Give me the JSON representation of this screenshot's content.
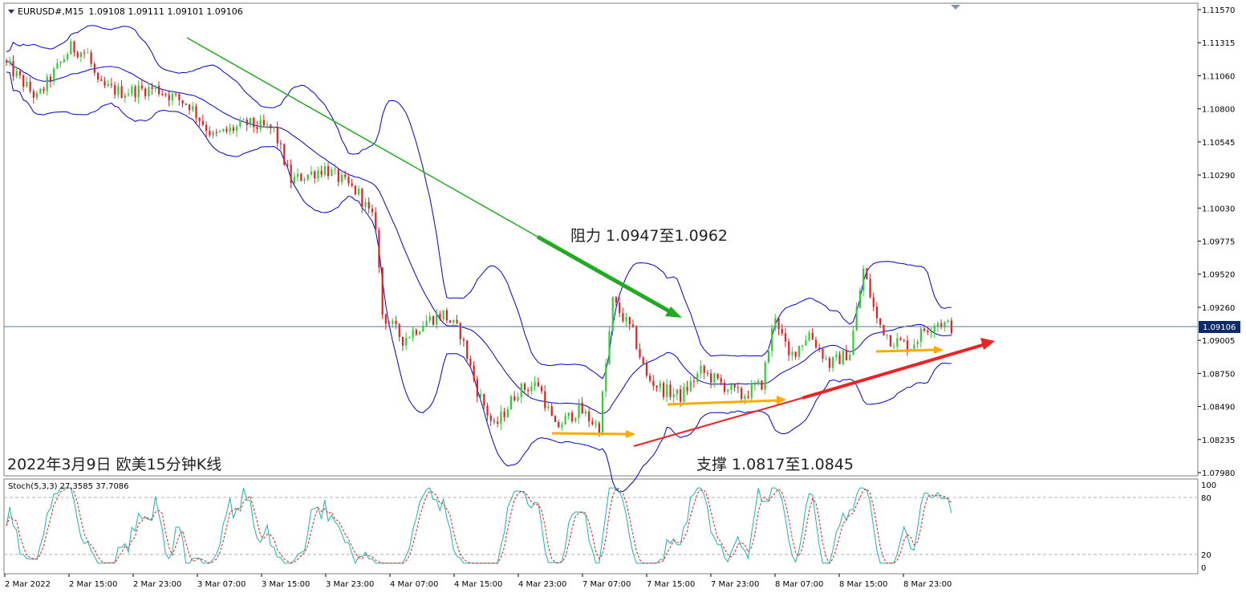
{
  "header": {
    "symbol": "EURUSD#,M15",
    "ohlc": "1.09108 1.09111 1.09101 1.09106"
  },
  "annotations": {
    "resistance": "阻力 1.0947至1.0962",
    "support": "支撑 1.0817至1.0845",
    "caption": "2022年3月9日 欧美15分钟K线"
  },
  "indicator": {
    "label": "Stoch(5,3,3) 27.3585 37.7086",
    "levels": [
      "100",
      "80",
      "20",
      "0"
    ]
  },
  "colors": {
    "up": "#33cc33",
    "down": "#dd2222",
    "band": "#0000cc",
    "resistance_arrow": "#22aa22",
    "support_arrow": "#ee2222",
    "horizontal_arrow": "#ffaa00",
    "stoch_main": "#20b2aa",
    "stoch_signal": "#dd2222"
  },
  "chart_data": {
    "type": "candlestick",
    "title": "EURUSD#,M15",
    "current_price": "1.09106",
    "y_ticks": [
      "1.11570",
      "1.11315",
      "1.11060",
      "1.10800",
      "1.10545",
      "1.10290",
      "1.10030",
      "1.09775",
      "1.09520",
      "1.09260",
      "1.09005",
      "1.08750",
      "1.08490",
      "1.08235",
      "1.07980"
    ],
    "ylim": [
      1.0795,
      1.116
    ],
    "x_ticks": [
      "2 Mar 2022",
      "2 Mar 15:00",
      "2 Mar 23:00",
      "3 Mar 07:00",
      "3 Mar 15:00",
      "3 Mar 23:00",
      "4 Mar 07:00",
      "4 Mar 15:00",
      "4 Mar 23:00",
      "7 Mar 07:00",
      "7 Mar 15:00",
      "7 Mar 23:00",
      "8 Mar 07:00",
      "8 Mar 15:00",
      "8 Mar 23:00"
    ],
    "price_path": [
      [
        0,
        1.112
      ],
      [
        5,
        1.1105
      ],
      [
        10,
        1.109
      ],
      [
        15,
        1.111
      ],
      [
        20,
        1.113
      ],
      [
        25,
        1.1125
      ],
      [
        28,
        1.11
      ],
      [
        35,
        1.1095
      ],
      [
        45,
        1.1098
      ],
      [
        55,
        1.1085
      ],
      [
        62,
        1.106
      ],
      [
        72,
        1.107
      ],
      [
        80,
        1.1065
      ],
      [
        85,
        1.1025
      ],
      [
        95,
        1.1035
      ],
      [
        105,
        1.1015
      ],
      [
        110,
        1.099
      ],
      [
        112,
        1.092
      ],
      [
        118,
        1.09
      ],
      [
        125,
        1.0915
      ],
      [
        130,
        1.092
      ],
      [
        135,
        1.0905
      ],
      [
        140,
        1.086
      ],
      [
        145,
        1.083
      ],
      [
        152,
        1.086
      ],
      [
        158,
        1.0865
      ],
      [
        163,
        1.083
      ],
      [
        170,
        1.0845
      ],
      [
        176,
        1.083
      ],
      [
        180,
        1.093
      ],
      [
        186,
        1.0905
      ],
      [
        190,
        1.087
      ],
      [
        195,
        1.086
      ],
      [
        200,
        1.0855
      ],
      [
        206,
        1.0875
      ],
      [
        212,
        1.0865
      ],
      [
        218,
        1.0855
      ],
      [
        224,
        1.0865
      ],
      [
        228,
        1.092
      ],
      [
        232,
        1.0885
      ],
      [
        238,
        1.0905
      ],
      [
        244,
        1.088
      ],
      [
        250,
        1.089
      ],
      [
        254,
        1.0955
      ],
      [
        258,
        1.0915
      ],
      [
        262,
        1.09
      ],
      [
        268,
        1.0895
      ],
      [
        272,
        1.0908
      ],
      [
        276,
        1.0914
      ],
      [
        280,
        1.091
      ]
    ],
    "resistance_line": [
      [
        1.114
      ],
      [
        1.0938
      ]
    ],
    "support_line": [
      [
        1.0822
      ],
      [
        1.09
      ]
    ],
    "series": [
      {
        "name": "Stoch(5,3,3) main",
        "last": 27.3585
      },
      {
        "name": "Stoch(5,3,3) signal",
        "last": 37.7086
      }
    ]
  }
}
